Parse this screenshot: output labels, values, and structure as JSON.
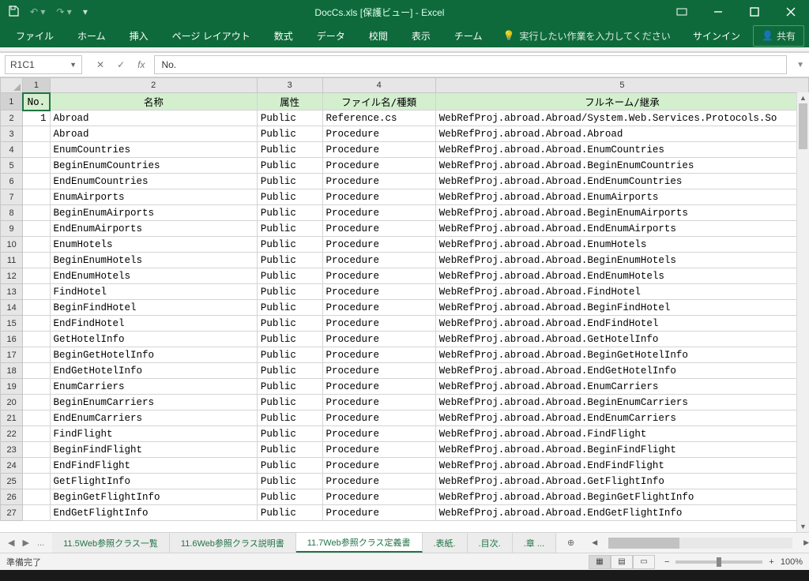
{
  "title": "DocCs.xls  [保護ビュー] - Excel",
  "ribbon": {
    "file": "ファイル",
    "home": "ホーム",
    "insert": "挿入",
    "page": "ページ レイアウト",
    "formula": "数式",
    "data": "データ",
    "review": "校閲",
    "view": "表示",
    "team": "チーム",
    "tellme": "実行したい作業を入力してください",
    "signin": "サインイン",
    "share": "共有"
  },
  "fx": {
    "name": "R1C1",
    "formula": "No."
  },
  "columns": [
    "1",
    "2",
    "3",
    "4",
    "5"
  ],
  "header": {
    "c1": "No.",
    "c2": "名称",
    "c3": "属性",
    "c4": "ファイル名/種類",
    "c5": "フルネーム/継承"
  },
  "rows": [
    {
      "n": "1",
      "c1": "1",
      "c2": "Abroad",
      "c3": "Public",
      "c4": "Reference.cs",
      "c5": "WebRefProj.abroad.Abroad/System.Web.Services.Protocols.So"
    },
    {
      "n": "2",
      "c1": "",
      "c2": "Abroad",
      "c3": "Public",
      "c4": "Procedure",
      "c5": "WebRefProj.abroad.Abroad.Abroad"
    },
    {
      "n": "3",
      "c1": "",
      "c2": "EnumCountries",
      "c3": "Public",
      "c4": "Procedure",
      "c5": "WebRefProj.abroad.Abroad.EnumCountries"
    },
    {
      "n": "4",
      "c1": "",
      "c2": "BeginEnumCountries",
      "c3": "Public",
      "c4": "Procedure",
      "c5": "WebRefProj.abroad.Abroad.BeginEnumCountries"
    },
    {
      "n": "5",
      "c1": "",
      "c2": "EndEnumCountries",
      "c3": "Public",
      "c4": "Procedure",
      "c5": "WebRefProj.abroad.Abroad.EndEnumCountries"
    },
    {
      "n": "6",
      "c1": "",
      "c2": "EnumAirports",
      "c3": "Public",
      "c4": "Procedure",
      "c5": "WebRefProj.abroad.Abroad.EnumAirports"
    },
    {
      "n": "7",
      "c1": "",
      "c2": "BeginEnumAirports",
      "c3": "Public",
      "c4": "Procedure",
      "c5": "WebRefProj.abroad.Abroad.BeginEnumAirports"
    },
    {
      "n": "8",
      "c1": "",
      "c2": "EndEnumAirports",
      "c3": "Public",
      "c4": "Procedure",
      "c5": "WebRefProj.abroad.Abroad.EndEnumAirports"
    },
    {
      "n": "9",
      "c1": "",
      "c2": "EnumHotels",
      "c3": "Public",
      "c4": "Procedure",
      "c5": "WebRefProj.abroad.Abroad.EnumHotels"
    },
    {
      "n": "10",
      "c1": "",
      "c2": "BeginEnumHotels",
      "c3": "Public",
      "c4": "Procedure",
      "c5": "WebRefProj.abroad.Abroad.BeginEnumHotels"
    },
    {
      "n": "11",
      "c1": "",
      "c2": "EndEnumHotels",
      "c3": "Public",
      "c4": "Procedure",
      "c5": "WebRefProj.abroad.Abroad.EndEnumHotels"
    },
    {
      "n": "12",
      "c1": "",
      "c2": "FindHotel",
      "c3": "Public",
      "c4": "Procedure",
      "c5": "WebRefProj.abroad.Abroad.FindHotel"
    },
    {
      "n": "13",
      "c1": "",
      "c2": "BeginFindHotel",
      "c3": "Public",
      "c4": "Procedure",
      "c5": "WebRefProj.abroad.Abroad.BeginFindHotel"
    },
    {
      "n": "14",
      "c1": "",
      "c2": "EndFindHotel",
      "c3": "Public",
      "c4": "Procedure",
      "c5": "WebRefProj.abroad.Abroad.EndFindHotel"
    },
    {
      "n": "15",
      "c1": "",
      "c2": "GetHotelInfo",
      "c3": "Public",
      "c4": "Procedure",
      "c5": "WebRefProj.abroad.Abroad.GetHotelInfo"
    },
    {
      "n": "16",
      "c1": "",
      "c2": "BeginGetHotelInfo",
      "c3": "Public",
      "c4": "Procedure",
      "c5": "WebRefProj.abroad.Abroad.BeginGetHotelInfo"
    },
    {
      "n": "17",
      "c1": "",
      "c2": "EndGetHotelInfo",
      "c3": "Public",
      "c4": "Procedure",
      "c5": "WebRefProj.abroad.Abroad.EndGetHotelInfo"
    },
    {
      "n": "18",
      "c1": "",
      "c2": "EnumCarriers",
      "c3": "Public",
      "c4": "Procedure",
      "c5": "WebRefProj.abroad.Abroad.EnumCarriers"
    },
    {
      "n": "19",
      "c1": "",
      "c2": "BeginEnumCarriers",
      "c3": "Public",
      "c4": "Procedure",
      "c5": "WebRefProj.abroad.Abroad.BeginEnumCarriers"
    },
    {
      "n": "20",
      "c1": "",
      "c2": "EndEnumCarriers",
      "c3": "Public",
      "c4": "Procedure",
      "c5": "WebRefProj.abroad.Abroad.EndEnumCarriers"
    },
    {
      "n": "21",
      "c1": "",
      "c2": "FindFlight",
      "c3": "Public",
      "c4": "Procedure",
      "c5": "WebRefProj.abroad.Abroad.FindFlight"
    },
    {
      "n": "22",
      "c1": "",
      "c2": "BeginFindFlight",
      "c3": "Public",
      "c4": "Procedure",
      "c5": "WebRefProj.abroad.Abroad.BeginFindFlight"
    },
    {
      "n": "23",
      "c1": "",
      "c2": "EndFindFlight",
      "c3": "Public",
      "c4": "Procedure",
      "c5": "WebRefProj.abroad.Abroad.EndFindFlight"
    },
    {
      "n": "24",
      "c1": "",
      "c2": "GetFlightInfo",
      "c3": "Public",
      "c4": "Procedure",
      "c5": "WebRefProj.abroad.Abroad.GetFlightInfo"
    },
    {
      "n": "25",
      "c1": "",
      "c2": "BeginGetFlightInfo",
      "c3": "Public",
      "c4": "Procedure",
      "c5": "WebRefProj.abroad.Abroad.BeginGetFlightInfo"
    },
    {
      "n": "26",
      "c1": "",
      "c2": "EndGetFlightInfo",
      "c3": "Public",
      "c4": "Procedure",
      "c5": "WebRefProj.abroad.Abroad.EndGetFlightInfo"
    }
  ],
  "sheetTabs": {
    "nav_more": "...",
    "t1": "11.5Web参照クラス一覧",
    "t2": "11.6Web参照クラス説明書",
    "t3": "11.7Web参照クラス定義書",
    "t4": ".表紙.",
    "t5": ".目次.",
    "t6": ".章 ...",
    "add": "⊕"
  },
  "status": {
    "ready": "準備完了",
    "zoom": "100%"
  }
}
